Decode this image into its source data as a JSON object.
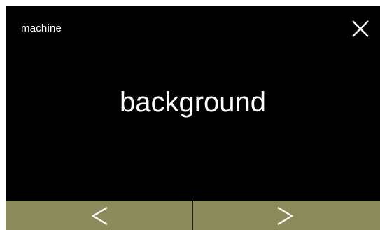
{
  "header": {
    "title": "machine",
    "close_icon": "close-icon"
  },
  "main": {
    "label": "background"
  },
  "nav": {
    "prev_icon": "chevron-left-icon",
    "next_icon": "chevron-right-icon",
    "bar_color": "#8a8a5a"
  },
  "colors": {
    "screen_background": "#000000",
    "text": "#ffffff"
  }
}
